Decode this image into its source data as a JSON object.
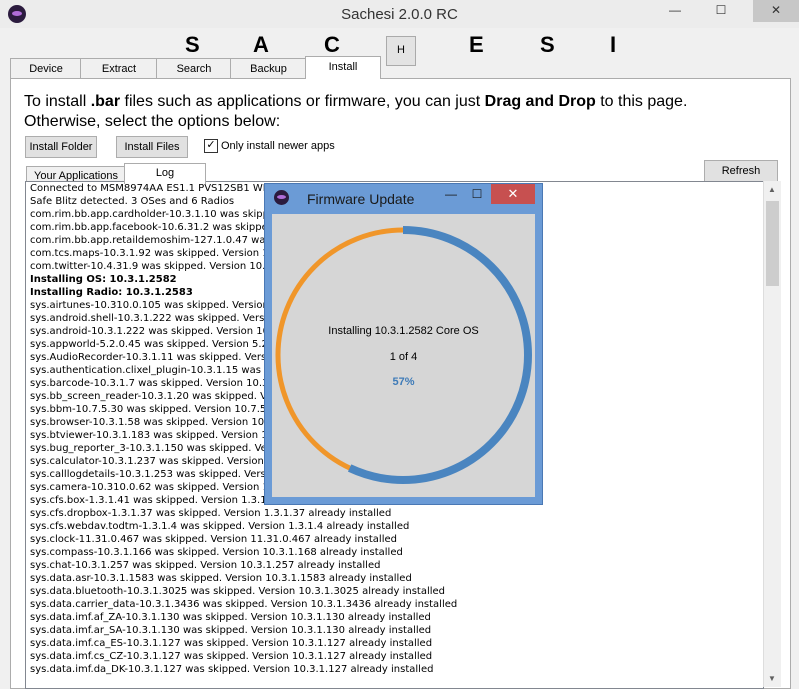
{
  "window": {
    "title": "Sachesi 2.0.0 RC",
    "minimize": "—",
    "maximize": "☐",
    "close": "✕"
  },
  "banner": {
    "letters": [
      "S",
      "A",
      "C",
      "E",
      "S",
      "I"
    ],
    "h_button": "H"
  },
  "tabs": [
    "Device",
    "Extract",
    "Search",
    "Backup",
    "Install"
  ],
  "install": {
    "intro_part1": "To install ",
    "intro_bold1": ".bar",
    "intro_part2": " files such as applications or firmware, you can just ",
    "intro_bold2": "Drag and Drop",
    "intro_part3": " to this page.",
    "intro_line2": "Otherwise, select the options below:",
    "install_folder": "Install Folder",
    "install_files": "Install Files",
    "only_newer_label": "Only install newer apps",
    "only_newer_checked": true,
    "refresh": "Refresh"
  },
  "subtabs": [
    "Your Applications",
    "Log"
  ],
  "log_lines": [
    {
      "text": "Connected to MSM8974AA ES1.1 PVS12SB1 WIN",
      "bold": false
    },
    {
      "text": "Safe Blitz detected. 3 OSes and 6 Radios",
      "bold": false
    },
    {
      "text": "com.rim.bb.app.cardholder-10.3.1.10 was skipped",
      "bold": false
    },
    {
      "text": "com.rim.bb.app.facebook-10.6.31.2 was skipped",
      "bold": false
    },
    {
      "text": "com.rim.bb.app.retaildemoshim-127.1.0.47 was s",
      "bold": false
    },
    {
      "text": "com.tcs.maps-10.3.1.92 was skipped. Version 10",
      "bold": false
    },
    {
      "text": "com.twitter-10.4.31.9 was skipped. Version 10.4",
      "bold": false
    },
    {
      "text": "Installing OS: 10.3.1.2582",
      "bold": true
    },
    {
      "text": "Installing Radio: 10.3.1.2583",
      "bold": true
    },
    {
      "text": "sys.airtunes-10.310.0.105 was skipped. Version",
      "bold": false
    },
    {
      "text": "sys.android.shell-10.3.1.222 was skipped. Version",
      "bold": false
    },
    {
      "text": "sys.android-10.3.1.222 was skipped. Version 10.",
      "bold": false
    },
    {
      "text": "sys.appworld-5.2.0.45 was skipped. Version 5.2.",
      "bold": false
    },
    {
      "text": "sys.AudioRecorder-10.3.1.11 was skipped. Versio",
      "bold": false
    },
    {
      "text": "sys.authentication.clixel_plugin-10.3.1.15 was sk",
      "bold": false
    },
    {
      "text": "sys.barcode-10.3.1.7 was skipped. Version 10.3",
      "bold": false
    },
    {
      "text": "sys.bb_screen_reader-10.3.1.20 was skipped. Ve",
      "bold": false
    },
    {
      "text": "sys.bbm-10.7.5.30 was skipped. Version 10.7.5.3",
      "bold": false
    },
    {
      "text": "sys.browser-10.3.1.58 was skipped. Version 10.3",
      "bold": false
    },
    {
      "text": "sys.btviewer-10.3.1.183 was skipped. Version 10",
      "bold": false
    },
    {
      "text": "sys.bug_reporter_3-10.3.1.150 was skipped. Vers",
      "bold": false
    },
    {
      "text": "sys.calculator-10.3.1.237 was skipped. Version 1",
      "bold": false
    },
    {
      "text": "sys.calllogdetails-10.3.1.253 was skipped. Versio",
      "bold": false
    },
    {
      "text": "sys.camera-10.310.0.62 was skipped. Version 10",
      "bold": false
    },
    {
      "text": "sys.cfs.box-1.3.1.41 was skipped. Version 1.3.1.41 already installed",
      "bold": false
    },
    {
      "text": "sys.cfs.dropbox-1.3.1.37 was skipped. Version 1.3.1.37 already installed",
      "bold": false
    },
    {
      "text": "sys.cfs.webdav.todtm-1.3.1.4 was skipped. Version 1.3.1.4 already installed",
      "bold": false
    },
    {
      "text": "sys.clock-11.31.0.467 was skipped. Version 11.31.0.467 already installed",
      "bold": false
    },
    {
      "text": "sys.compass-10.3.1.166 was skipped. Version 10.3.1.168 already installed",
      "bold": false
    },
    {
      "text": "sys.chat-10.3.1.257 was skipped. Version 10.3.1.257 already installed",
      "bold": false
    },
    {
      "text": "sys.data.asr-10.3.1.1583 was skipped. Version 10.3.1.1583 already installed",
      "bold": false
    },
    {
      "text": "sys.data.bluetooth-10.3.1.3025 was skipped. Version 10.3.1.3025 already installed",
      "bold": false
    },
    {
      "text": "sys.data.carrier_data-10.3.1.3436 was skipped. Version 10.3.1.3436 already installed",
      "bold": false
    },
    {
      "text": "sys.data.imf.af_ZA-10.3.1.130 was skipped. Version 10.3.1.130 already installed",
      "bold": false
    },
    {
      "text": "sys.data.imf.ar_SA-10.3.1.130 was skipped. Version 10.3.1.130 already installed",
      "bold": false
    },
    {
      "text": "sys.data.imf.ca_ES-10.3.1.127 was skipped. Version 10.3.1.127 already installed",
      "bold": false
    },
    {
      "text": "sys.data.imf.cs_CZ-10.3.1.127 was skipped. Version 10.3.1.127 already installed",
      "bold": false
    },
    {
      "text": "sys.data.imf.da_DK-10.3.1.127 was skipped. Version 10.3.1.127 already installed",
      "bold": false
    }
  ],
  "dialog": {
    "title": "Firmware Update",
    "minimize": "—",
    "maximize": "☐",
    "close": "✕",
    "status": "Installing 10.3.1.2582 Core OS",
    "step": "1 of 4",
    "percent_label": "57%",
    "progress_fraction": 0.57,
    "colors": {
      "progress": "#4a85c0",
      "remaining": "#f0962a"
    }
  }
}
